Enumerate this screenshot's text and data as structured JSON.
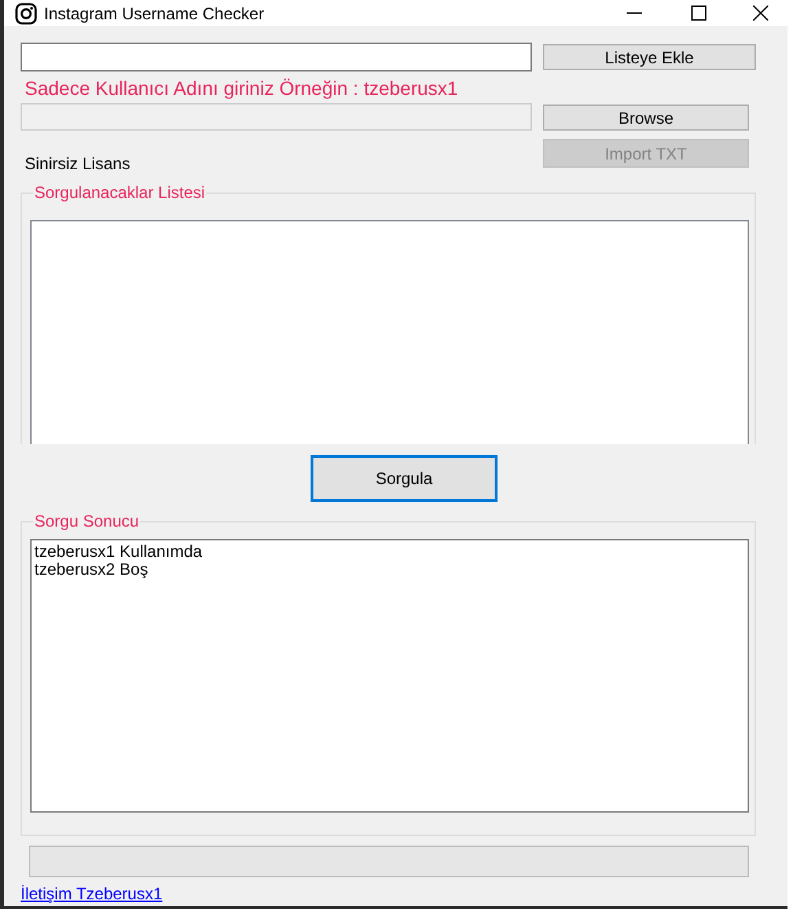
{
  "window": {
    "title": "Instagram Username Checker"
  },
  "add_button": {
    "label": "Listeye Ekle"
  },
  "hint": "Sadece Kullanıcı Adını giriniz Örneğin : tzeberusx1",
  "file_field": {
    "disabled": true
  },
  "browse_button": {
    "label": "Browse"
  },
  "license_label": "Sinirsiz Lisans",
  "import_button": {
    "label": "Import TXT",
    "disabled": true
  },
  "query_list": {
    "title": "Sorgulanacaklar Listesi"
  },
  "query_button": {
    "label": "Sorgula",
    "focused": true
  },
  "results": {
    "title": "Sorgu Sonucu",
    "lines": [
      "tzeberusx1 Kullanımda",
      "tzeberusx2 Boş"
    ]
  },
  "progress": {
    "level": 0
  },
  "contact_link": "İletişim Tzeberusx1"
}
